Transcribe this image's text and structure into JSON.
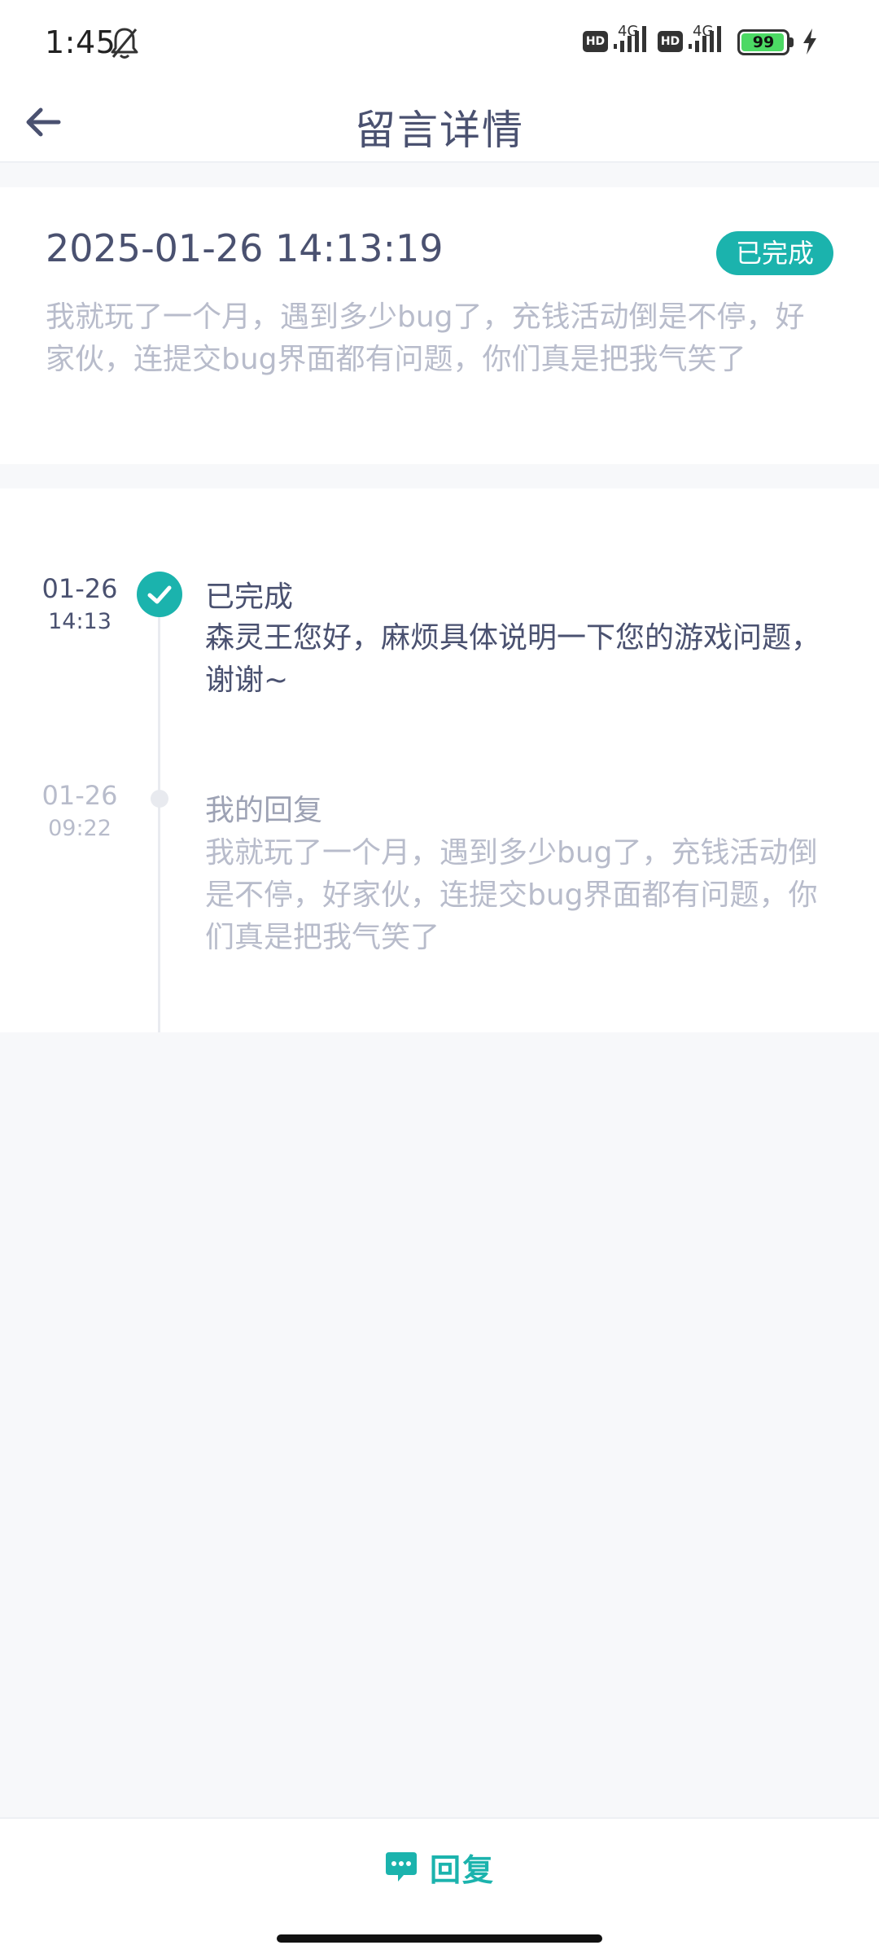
{
  "status_bar": {
    "time": "1:45",
    "hd_label": "HD",
    "network_label": "4G",
    "battery": "99"
  },
  "header": {
    "title": "留言详情"
  },
  "message": {
    "datetime": "2025-01-26 14:13:19",
    "status": "已完成",
    "content": "我就玩了一个月，遇到多少bug了，充钱活动倒是不停，好家伙，连提交bug界面都有问题，你们真是把我气笑了"
  },
  "timeline": [
    {
      "date": "01-26",
      "time": "14:13",
      "title": "已完成",
      "content": "森灵王您好，麻烦具体说明一下您的游戏问题，谢谢~"
    },
    {
      "date": "01-26",
      "time": "09:22",
      "title": "我的回复",
      "content": "我就玩了一个月，遇到多少bug了，充钱活动倒是不停，好家伙，连提交bug界面都有问题，你们真是把我气笑了"
    }
  ],
  "bottom": {
    "reply_label": "回复"
  },
  "colors": {
    "accent": "#1bb3ad",
    "title_text": "#4a5170",
    "muted_text": "#b8bccb",
    "background": "#f7f8fa"
  }
}
